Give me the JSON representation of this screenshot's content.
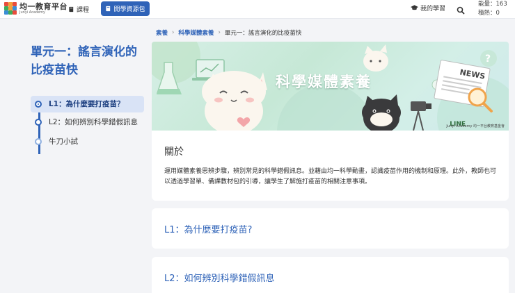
{
  "header": {
    "logo_title": "均一教育平台",
    "logo_sub": "Junyi Academy",
    "nav_courses": "課程",
    "nav_resources": "開學資源包",
    "nav_my_learning": "我的學習",
    "energy": "能量：163",
    "badges": "積熱：0"
  },
  "breadcrumb": {
    "items": [
      "素養",
      "科學媒體素養",
      "單元一：謠言演化的比疫苗快"
    ]
  },
  "sidebar": {
    "unit_title": "單元一：謠言演化的比疫苗快",
    "lessons": [
      {
        "label": "L1：為什麼要打疫苗？",
        "active": true
      },
      {
        "label": "L2：如何辨別科學錯假訊息",
        "active": false
      },
      {
        "label": "牛刀小試",
        "active": false
      }
    ]
  },
  "banner": {
    "title": "科學媒體素養",
    "brand_line": "LINE",
    "brand_junyi": "Junyi Academy 均一平台教育基金會"
  },
  "about": {
    "heading": "關於",
    "body": "運用媒體素養思辨步驟，辨別常見的科學錯假訊息。並藉由均一科學動畫，認識疫苗作用的機制和原理。此外，教師也可以透過學習單、備課教材包的引導，讓學生了解施打疫苗的相關注意事項。"
  },
  "lesson_cards": [
    {
      "title": "L1：為什麼要打疫苗?"
    },
    {
      "title": "L2：如何辨別科學錯假訊息"
    }
  ],
  "colors": {
    "accent": "#2f63b8",
    "active_bg": "#d9e3f6",
    "page_bg": "#f3f4f7"
  }
}
